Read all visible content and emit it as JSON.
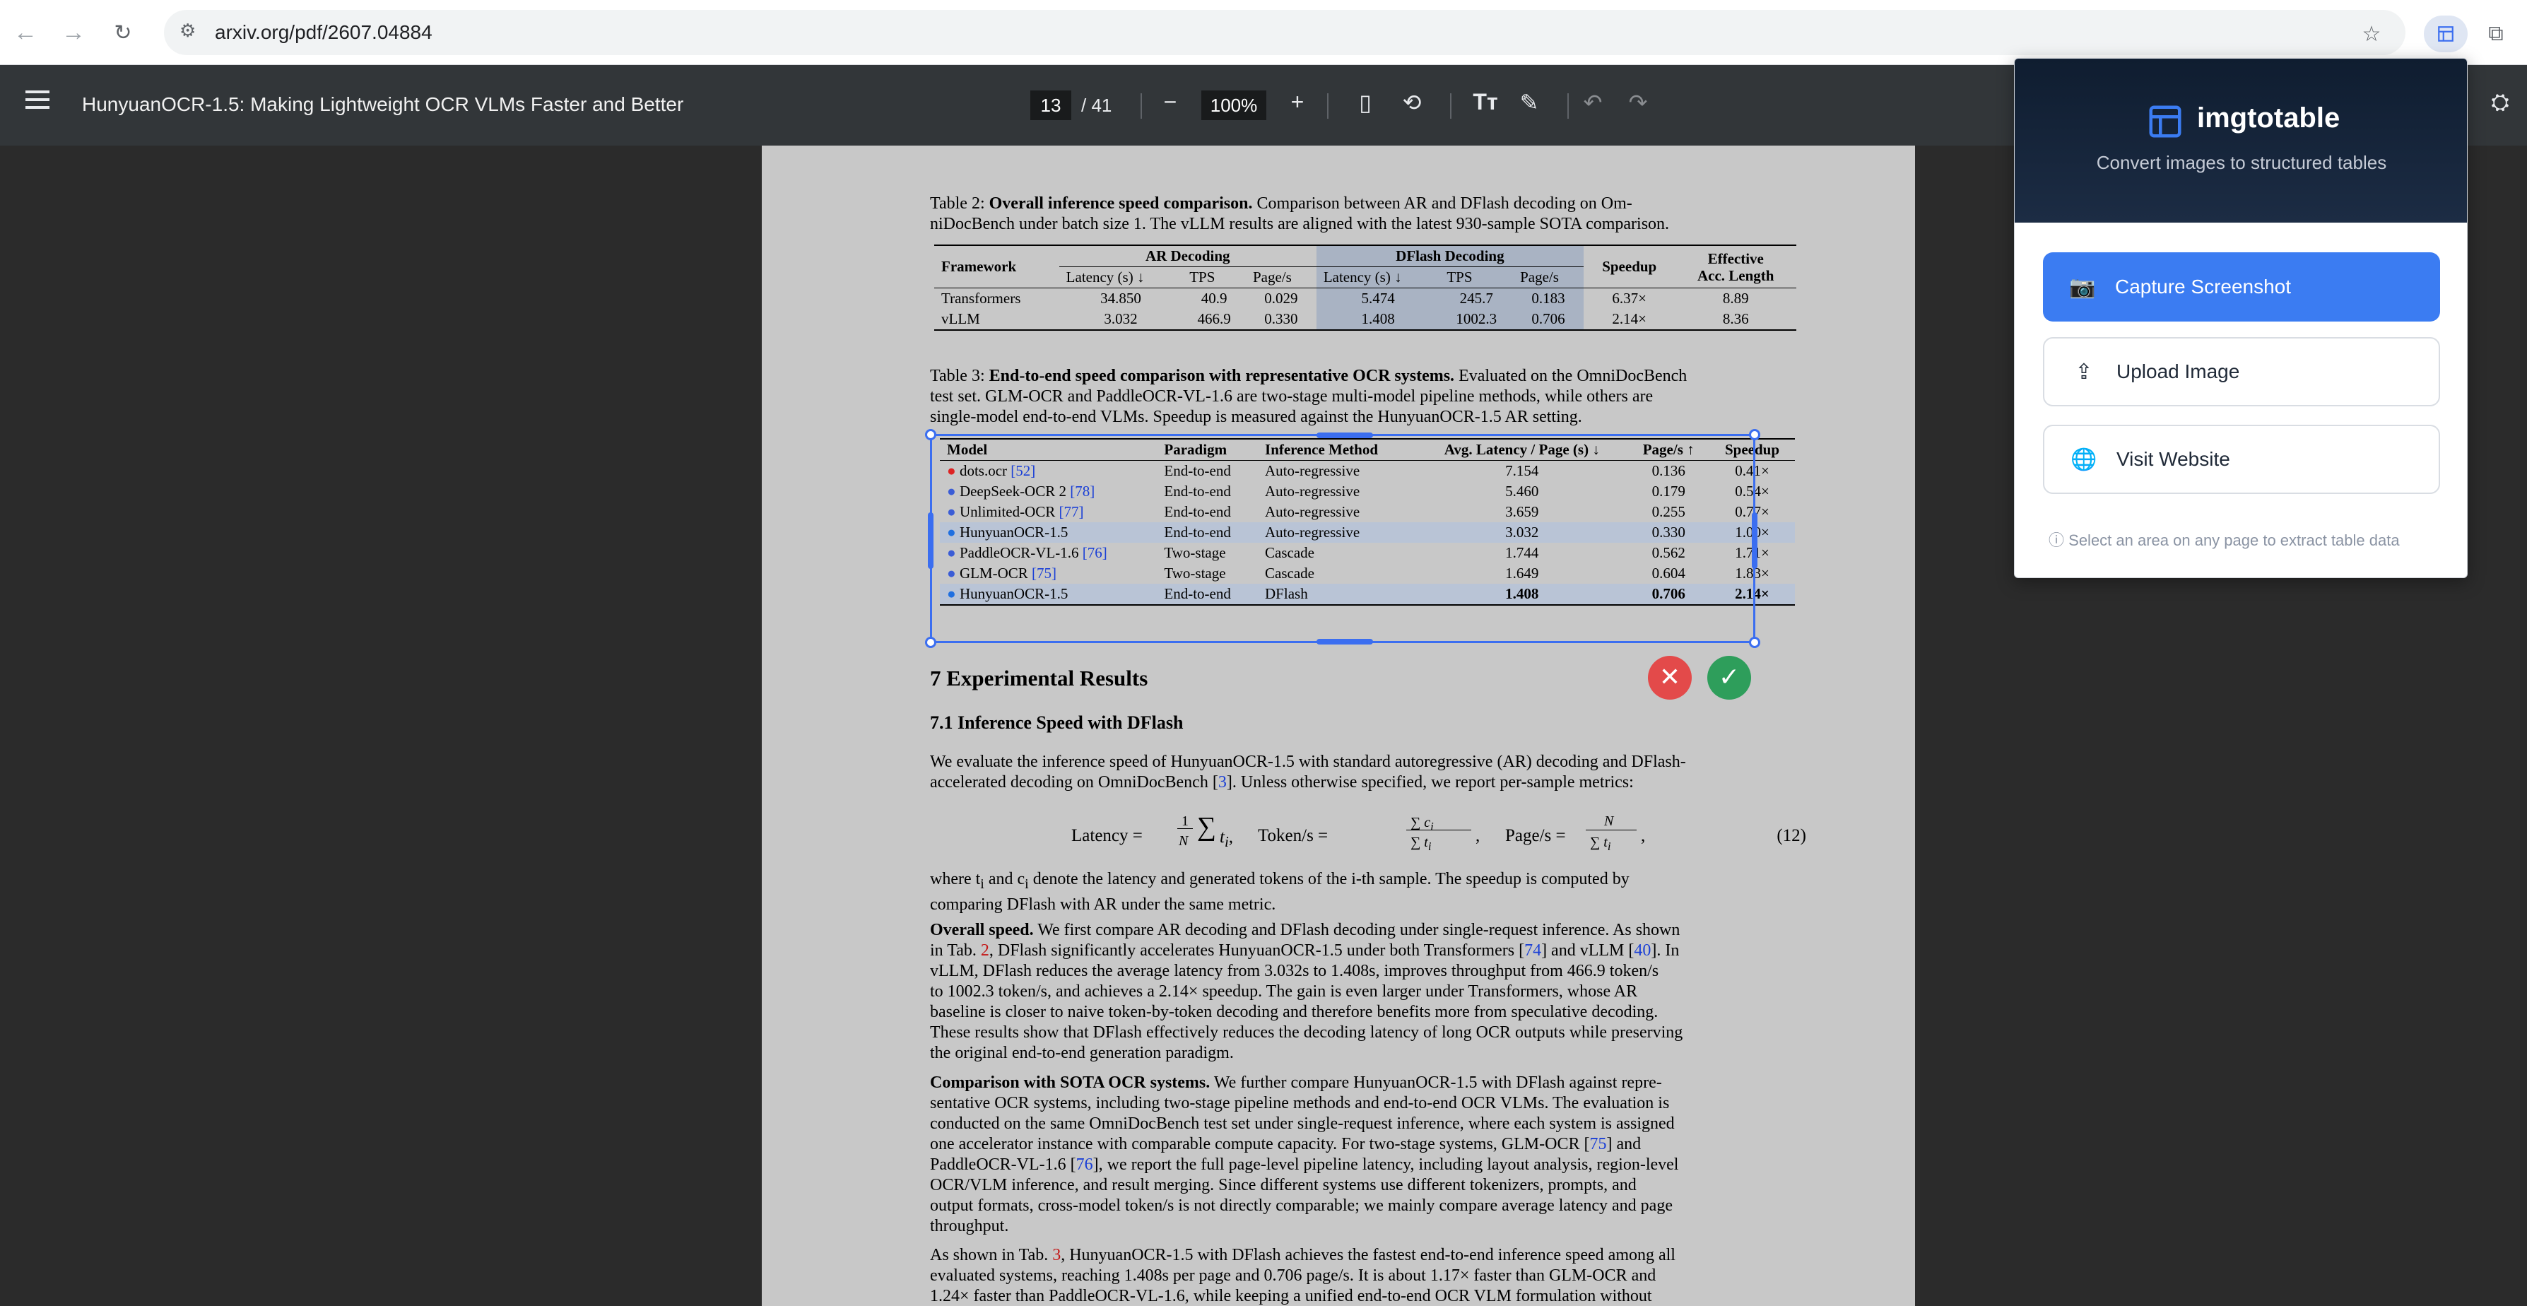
{
  "browser": {
    "url": "arxiv.org/pdf/2607.04884"
  },
  "toolbar": {
    "title": "HunyuanOCR-1.5: Making Lightweight OCR VLMs Faster and Better",
    "page_current": "13",
    "page_total": "/ 41",
    "zoom": "100%"
  },
  "doc": {
    "table2_caption_label": "Table 2:",
    "table2_caption_bold": "Overall inference speed comparison.",
    "table2_caption_rest1": "Comparison between AR and DFlash decoding on Om-",
    "table2_caption_rest2": "niDocBench under batch size 1. The vLLM results are aligned with the latest 930-sample SOTA comparison.",
    "table2": {
      "h_framework": "Framework",
      "h_ar": "AR Decoding",
      "h_dflash": "DFlash Decoding",
      "h_speedup": "Speedup",
      "h_eff1": "Effective",
      "h_eff2": "Acc. Length",
      "sub_latency": "Latency (s) ↓",
      "sub_tps": "TPS",
      "sub_pages": "Page/s",
      "rows": [
        {
          "fw": "Transformers",
          "ar_lat": "34.850",
          "ar_tps": "40.9",
          "ar_pg": "0.029",
          "df_lat": "5.474",
          "df_tps": "245.7",
          "df_pg": "0.183",
          "sp": "6.37×",
          "eff": "8.89"
        },
        {
          "fw": "vLLM",
          "ar_lat": "3.032",
          "ar_tps": "466.9",
          "ar_pg": "0.330",
          "df_lat": "1.408",
          "df_tps": "1002.3",
          "df_pg": "0.706",
          "sp": "2.14×",
          "eff": "8.36"
        }
      ]
    },
    "table3_caption_label": "Table 3:",
    "table3_caption_bold": "End-to-end speed comparison with representative OCR systems.",
    "table3_caption_rest1": "Evaluated on the OmniDocBench",
    "table3_caption_rest2": "test set. GLM-OCR and PaddleOCR-VL-1.6 are two-stage multi-model pipeline methods, while others are",
    "table3_caption_rest3": "single-model end-to-end VLMs. Speedup is measured against the HunyuanOCR-1.5 AR setting.",
    "table3": {
      "h_model": "Model",
      "h_paradigm": "Paradigm",
      "h_method": "Inference Method",
      "h_latency": "Avg. Latency / Page (s) ↓",
      "h_pages": "Page/s ↑",
      "h_speedup": "Speedup",
      "rows": [
        {
          "model": "dots.ocr",
          "ref": "[52]",
          "paradigm": "End-to-end",
          "method": "Auto-regressive",
          "lat": "7.154",
          "pg": "0.136",
          "sp": "0.41×"
        },
        {
          "model": "DeepSeek-OCR 2",
          "ref": "[78]",
          "paradigm": "End-to-end",
          "method": "Auto-regressive",
          "lat": "5.460",
          "pg": "0.179",
          "sp": "0.54×"
        },
        {
          "model": "Unlimited-OCR",
          "ref": "[77]",
          "paradigm": "End-to-end",
          "method": "Auto-regressive",
          "lat": "3.659",
          "pg": "0.255",
          "sp": "0.77×"
        },
        {
          "model": "HunyuanOCR-1.5",
          "ref": "",
          "paradigm": "End-to-end",
          "method": "Auto-regressive",
          "lat": "3.032",
          "pg": "0.330",
          "sp": "1.00×"
        },
        {
          "model": "PaddleOCR-VL-1.6",
          "ref": "[76]",
          "paradigm": "Two-stage",
          "method": "Cascade",
          "lat": "1.744",
          "pg": "0.562",
          "sp": "1.71×"
        },
        {
          "model": "GLM-OCR",
          "ref": "[75]",
          "paradigm": "Two-stage",
          "method": "Cascade",
          "lat": "1.649",
          "pg": "0.604",
          "sp": "1.83×"
        },
        {
          "model": "HunyuanOCR-1.5",
          "ref": "",
          "paradigm": "End-to-end",
          "method": "DFlash",
          "lat": "1.408",
          "pg": "0.706",
          "sp": "2.14×"
        }
      ]
    },
    "section7": "7   Experimental Results",
    "section71": "7.1   Inference Speed with DFlash",
    "p1_l1": "We evaluate the inference speed of HunyuanOCR-1.5 with standard autoregressive (AR) decoding and DFlash-",
    "p1_l2a": "accelerated decoding on OmniDocBench [",
    "p1_l2ref": "3",
    "p1_l2b": "]. Unless otherwise specified, we report per-sample metrics:",
    "eq_latency": "Latency = ",
    "eq_tokens": "Token/s = ",
    "eq_pages": "Page/s = ",
    "eq_num": "(12)",
    "p2_l1": "where t",
    "p2_l1b": " and c",
    "p2_l1c": " denote the latency and generated tokens of the i-th sample. The speedup is computed by",
    "p2_l2": "comparing DFlash with AR under the same metric.",
    "p3_bold": "Overall speed.",
    "p3_l1": " We first compare AR decoding and DFlash decoding under single-request inference. As shown",
    "p3_l2a": "in Tab. ",
    "p3_l2ref": "2",
    "p3_l2b": ", DFlash significantly accelerates HunyuanOCR-1.5 under both Transformers [",
    "p3_l2ref2": "74",
    "p3_l2c": "] and vLLM [",
    "p3_l2ref3": "40",
    "p3_l2d": "]. In",
    "p3_l3": "vLLM, DFlash reduces the average latency from 3.032s to 1.408s, improves throughput from 466.9 token/s",
    "p3_l4": "to 1002.3 token/s, and achieves a 2.14× speedup. The gain is even larger under Transformers, whose AR",
    "p3_l5": "baseline is closer to naive token-by-token decoding and therefore benefits more from speculative decoding.",
    "p3_l6": "These results show that DFlash effectively reduces the decoding latency of long OCR outputs while preserving",
    "p3_l7": "the original end-to-end generation paradigm.",
    "p4_bold": "Comparison with SOTA OCR systems.",
    "p4_l1": " We further compare HunyuanOCR-1.5 with DFlash against repre-",
    "p4_l2": "sentative OCR systems, including two-stage pipeline methods and end-to-end OCR VLMs. The evaluation is",
    "p4_l3": "conducted on the same OmniDocBench test set under single-request inference, where each system is assigned",
    "p4_l4a": "one accelerator instance with comparable compute capacity. For two-stage systems, GLM-OCR [",
    "p4_l4ref": "75",
    "p4_l4b": "] and",
    "p4_l5a": "PaddleOCR-VL-1.6 [",
    "p4_l5ref": "76",
    "p4_l5b": "], we report the full page-level pipeline latency, including layout analysis, region-level",
    "p4_l6": "OCR/VLM inference, and result merging. Since different systems use different tokenizers, prompts, and",
    "p4_l7": "output formats, cross-model token/s is not directly comparable; we mainly compare average latency and page",
    "p4_l8": "throughput.",
    "p5_l1a": "As shown in Tab. ",
    "p5_l1ref": "3",
    "p5_l1b": ", HunyuanOCR-1.5 with DFlash achieves the fastest end-to-end inference speed among all",
    "p5_l2": "evaluated systems, reaching 1.408s per page and 0.706 page/s. It is about 1.17× faster than GLM-OCR and",
    "p5_l3": "1.24× faster than PaddleOCR-VL-1.6, while keeping a unified end-to-end OCR VLM formulation without"
  },
  "popup": {
    "name": "imgtotable",
    "subtitle": "Convert images to structured tables",
    "capture": "Capture Screenshot",
    "upload": "Upload Image",
    "visit": "Visit Website",
    "hint": "Select an area on any page to extract table data"
  },
  "colors": {
    "accent": "#3b7cf2",
    "selection": "#3b6ef0",
    "cancel": "#e34a4a",
    "confirm": "#2e9e5b"
  }
}
